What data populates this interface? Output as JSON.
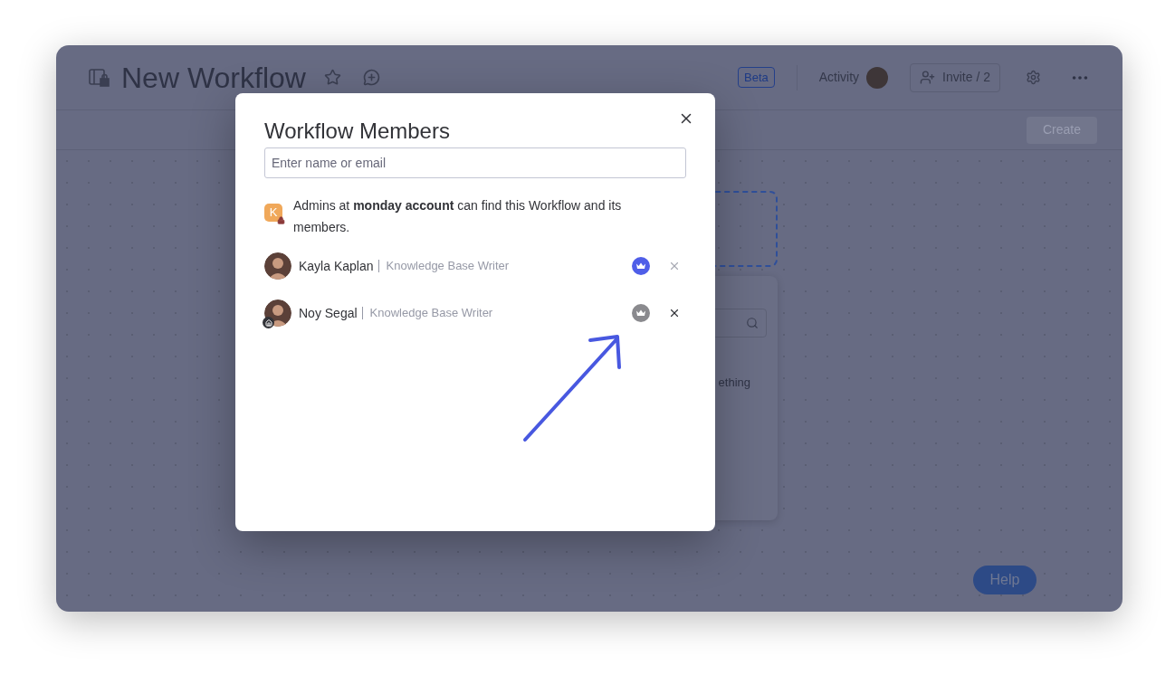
{
  "header": {
    "title": "New Workflow",
    "beta": "Beta",
    "activity": "Activity",
    "invite": "Invite / 2"
  },
  "toolbar": {
    "create": "Create"
  },
  "canvas": {
    "panel_text": "ething"
  },
  "help": "Help",
  "dialog": {
    "title": "Workflow Members",
    "search": {
      "placeholder": "Enter name or email"
    },
    "notice": "Admins at **monday account** can find this Workflow and its members.",
    "notice_badge": "K",
    "members": [
      {
        "name": "Kayla Kaplan",
        "role": "Knowledge Base Writer",
        "owner": true
      },
      {
        "name": "Noy Segal",
        "role": "Knowledge Base Writer",
        "owner": false
      }
    ]
  }
}
